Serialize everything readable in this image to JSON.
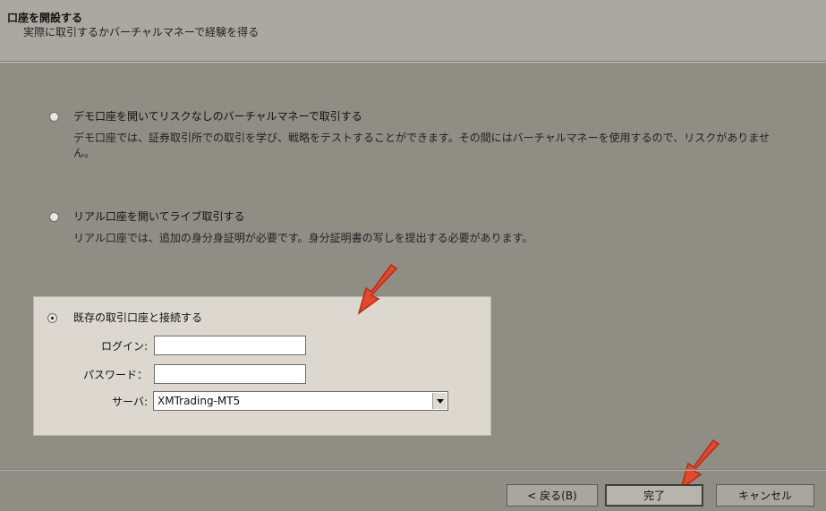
{
  "header": {
    "title": "口座を開設する",
    "subtitle": "実際に取引するかバーチャルマネーで経験を得る"
  },
  "options": {
    "demo": {
      "label": "デモ口座を開いてリスクなしのバーチャルマネーで取引する",
      "description": "デモ口座では、証券取引所での取引を学び、戦略をテストすることができます。その間にはバーチャルマネーを使用するので、リスクがありません。"
    },
    "real": {
      "label": "リアル口座を開いてライブ取引する",
      "description": "リアル口座では、追加の身分身証明が必要です。身分証明書の写しを提出する必要があります。"
    },
    "existing": {
      "label": "既存の取引口座と接続する",
      "login_label": "ログイン:",
      "login_value": "",
      "password_label": "パスワード：",
      "password_value": "",
      "server_label": "サーバ:",
      "server_value": "XMTrading-MT5"
    }
  },
  "footer": {
    "back_label": "< 戻る(B)",
    "finish_label": "完了",
    "cancel_label": "キャンセル"
  },
  "colors": {
    "background": "#8f8e85",
    "header": "#a9a8a1",
    "panel": "#dcd8d0",
    "arrow": "#e8462a"
  }
}
